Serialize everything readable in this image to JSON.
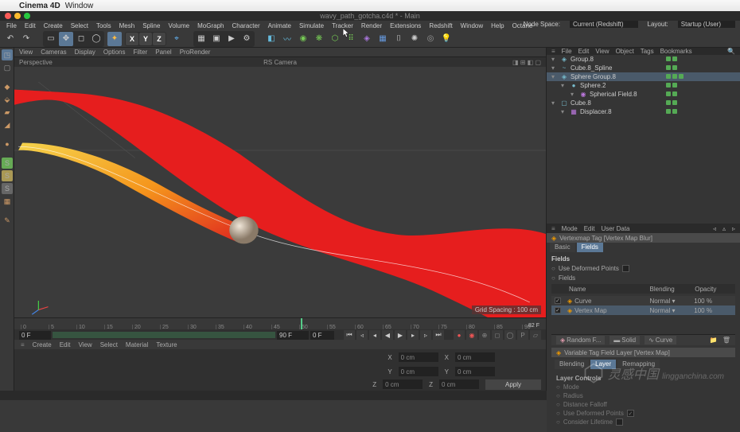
{
  "mac": {
    "app": "Cinema 4D",
    "menu": "Window"
  },
  "title": {
    "doc": "wavy_path_gotcha.c4d * - Main"
  },
  "mainmenu": [
    "File",
    "Edit",
    "Create",
    "Select",
    "Tools",
    "Mesh",
    "Spline",
    "Volume",
    "MoGraph",
    "Character",
    "Animate",
    "Simulate",
    "Tracker",
    "Render",
    "Extensions",
    "Redshift",
    "Window",
    "Help",
    "Octane"
  ],
  "nodespace": {
    "label": "Node Space:",
    "value": "Current (Redshift)"
  },
  "layoutlbl": {
    "label": "Layout:",
    "value": "Startup (User)"
  },
  "viewmenu": [
    "View",
    "Cameras",
    "Display",
    "Options",
    "Filter",
    "Panel",
    "ProRender"
  ],
  "vp": {
    "persp": "Perspective",
    "cam": "RS Camera",
    "grid": "Grid Spacing : 100 cm"
  },
  "timeline": {
    "start": "0 F",
    "end": "90 F",
    "cur": "0 F",
    "fin": "82 F",
    "ticks": [
      "0",
      "5",
      "10",
      "15",
      "20",
      "25",
      "30",
      "35",
      "40",
      "45",
      "50",
      "55",
      "60",
      "65",
      "70",
      "75",
      "80",
      "85",
      "90"
    ]
  },
  "bottommenu": [
    "Create",
    "Edit",
    "View",
    "Select",
    "Material",
    "Texture"
  ],
  "coords": {
    "x": "X",
    "y": "Y",
    "z": "Z",
    "apply": "Apply",
    "cm": "0 cm"
  },
  "objpanel": {
    "tabs": [
      "File",
      "Edit",
      "View",
      "Object",
      "Tags",
      "Bookmarks"
    ]
  },
  "tree": [
    {
      "name": "Group.8",
      "ind": 0,
      "icon": "◈",
      "color": "#7bc"
    },
    {
      "name": "Cube.8_Spline",
      "ind": 0,
      "icon": "~",
      "color": "#7bc"
    },
    {
      "name": "Sphere Group.8",
      "ind": 0,
      "icon": "◈",
      "color": "#7bc",
      "sel": true
    },
    {
      "name": "Sphere.2",
      "ind": 1,
      "icon": "●",
      "color": "#7bc"
    },
    {
      "name": "Spherical Field.8",
      "ind": 2,
      "icon": "◉",
      "color": "#b7d"
    },
    {
      "name": "Cube.8",
      "ind": 0,
      "icon": "▢",
      "color": "#7bc"
    },
    {
      "name": "Displacer.8",
      "ind": 1,
      "icon": "▦",
      "color": "#b7d"
    }
  ],
  "attr": {
    "head": [
      "Mode",
      "Edit",
      "User Data"
    ],
    "title": "Vertexmap Tag [Vertex Map Blur]",
    "tabs": [
      "Basic",
      "Fields"
    ],
    "tab_sel": 1,
    "section": "Fields",
    "useDeformed": "Use Deformed Points",
    "fieldsRow": "Fields",
    "headrow": [
      "Name",
      "Blending",
      "Opacity"
    ],
    "rows": [
      {
        "name": "Curve",
        "blend": "Normal",
        "op": "100 %"
      },
      {
        "name": "Vertex Map",
        "blend": "Normal",
        "op": "100 %"
      }
    ]
  },
  "layerbar": [
    "Random F...",
    "Solid",
    "Curve"
  ],
  "tagtitle": "Variable Tag Field Layer [Vertex Map]",
  "subtabs": [
    "Blending",
    "Layer",
    "Remapping"
  ],
  "layersec": {
    "title": "Layer Controls",
    "items": [
      "Mode",
      "Radius",
      "Distance Falloff",
      "Use Deformed Points",
      "Consider Lifetime"
    ]
  }
}
